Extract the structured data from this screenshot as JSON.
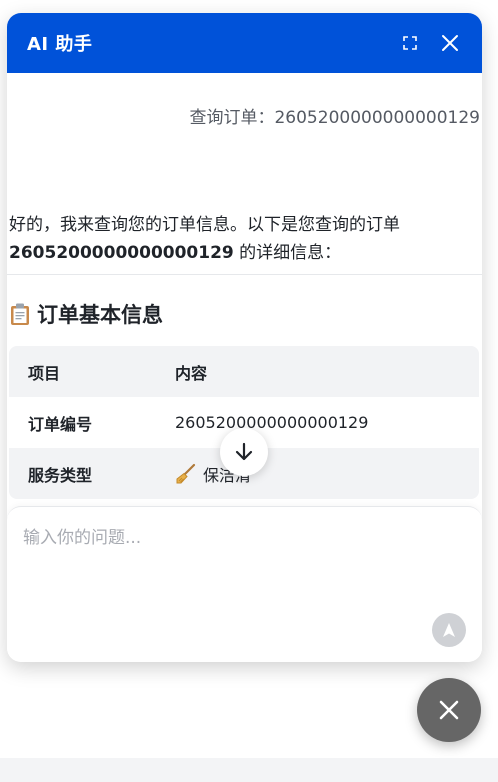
{
  "header": {
    "title": "AI 助手",
    "icons": [
      "fullscreen-icon",
      "close-icon"
    ]
  },
  "messages": {
    "user_query": "查询订单：2605200000000000129",
    "ai_intro_prefix": "好的，我来查询您的订单信息。以下是您查询的订单",
    "ai_intro_order": "2605200000000000129",
    "ai_intro_suffix": " 的详细信息：",
    "section_title": "订单基本信息",
    "section_icon": "clipboard-icon"
  },
  "table": {
    "headers": [
      "项目",
      "内容"
    ],
    "rows": [
      {
        "key": "订单编号",
        "value": "2605200000000000129"
      },
      {
        "key": "服务类型",
        "value": "保洁清",
        "icon": "broom-icon"
      }
    ]
  },
  "input": {
    "placeholder": "输入你的问题..."
  },
  "colors": {
    "primary": "#0052d9",
    "fab": "#666666",
    "send_disabled": "#cfd1d5"
  }
}
